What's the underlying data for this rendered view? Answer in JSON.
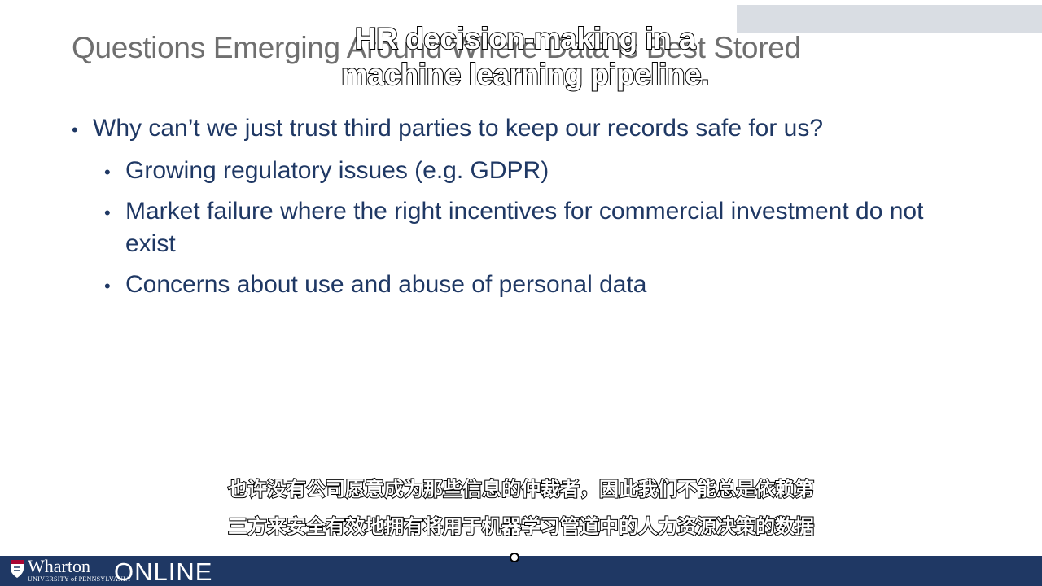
{
  "slide": {
    "title": "Questions Emerging Around Where Data is Best Stored",
    "bullets": [
      {
        "text": "Why can’t we just trust third parties to keep our records safe for us?",
        "sub": [
          "Growing regulatory issues (e.g. GDPR)",
          "Market failure where the right incentives for commercial investment do not exist",
          "Concerns about use and abuse of personal data"
        ]
      }
    ]
  },
  "overlay_caption": {
    "line1": "HR decision-making in a",
    "line2": "machine learning pipeline."
  },
  "subtitle": {
    "line1": "也许没有公司愿意成为那些信息的仲裁者，因此我们不能总是依赖第",
    "line2": "三方来安全有效地拥有将用于机器学习管道中的人力资源决策的数据"
  },
  "footer": {
    "wharton": "Wharton",
    "university": "UNIVERSITY of PENNSYLVANIA",
    "online": "ONLINE"
  },
  "colors": {
    "bullet_text": "#1f3864",
    "title_text": "#6f6f6f",
    "footer_bar": "#1f3864"
  }
}
